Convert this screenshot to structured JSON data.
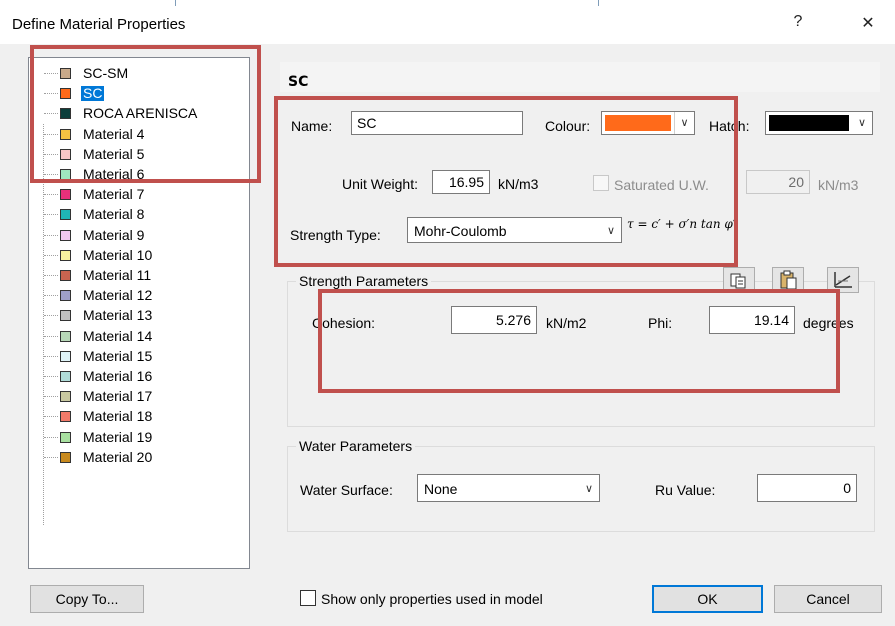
{
  "window": {
    "title": "Define Material Properties",
    "help_glyph": "?",
    "close_glyph": "✕"
  },
  "materials": [
    {
      "label": "SC-SM",
      "color": "#c8a98a",
      "selected": false
    },
    {
      "label": "SC",
      "color": "#ff6a1a",
      "selected": true
    },
    {
      "label": "ROCA ARENISCA",
      "color": "#0b3d3a",
      "selected": false
    },
    {
      "label": "Material 4",
      "color": "#f5c242",
      "selected": false
    },
    {
      "label": "Material 5",
      "color": "#f7c6c6",
      "selected": false
    },
    {
      "label": "Material 6",
      "color": "#9fe8c0",
      "selected": false
    },
    {
      "label": "Material 7",
      "color": "#e8307a",
      "selected": false
    },
    {
      "label": "Material 8",
      "color": "#1fb5b5",
      "selected": false
    },
    {
      "label": "Material 9",
      "color": "#f2c8f0",
      "selected": false
    },
    {
      "label": "Material 10",
      "color": "#f7f2a0",
      "selected": false
    },
    {
      "label": "Material 11",
      "color": "#c86450",
      "selected": false
    },
    {
      "label": "Material 12",
      "color": "#9fa0c8",
      "selected": false
    },
    {
      "label": "Material 13",
      "color": "#c0c0c0",
      "selected": false
    },
    {
      "label": "Material 14",
      "color": "#b8d8b8",
      "selected": false
    },
    {
      "label": "Material 15",
      "color": "#e0f4f8",
      "selected": false
    },
    {
      "label": "Material 16",
      "color": "#b0dcd8",
      "selected": false
    },
    {
      "label": "Material 17",
      "color": "#c8c8a0",
      "selected": false
    },
    {
      "label": "Material 18",
      "color": "#f07a6a",
      "selected": false
    },
    {
      "label": "Material 19",
      "color": "#a8e0a0",
      "selected": false
    },
    {
      "label": "Material 20",
      "color": "#c88a1e",
      "selected": false
    }
  ],
  "material_header": "SC",
  "general": {
    "name_label": "Name:",
    "name_value": "SC",
    "colour_label": "Colour:",
    "colour_value": "#ff6a1a",
    "hatch_label": "Hatch:",
    "hatch_value": "#000000",
    "unit_weight_label": "Unit Weight:",
    "unit_weight_value": "16.95",
    "unit_weight_unit": "kN/m3",
    "saturated_label": "Saturated U.W.",
    "saturated_value": "20",
    "saturated_unit": "kN/m3",
    "strength_type_label": "Strength Type:",
    "strength_type_value": "Mohr-Coulomb",
    "formula": "τ = c′ + σ′n tan φ′"
  },
  "strength_parameters": {
    "title": "Strength Parameters",
    "cohesion_label": "Cohesion:",
    "cohesion_value": "5.276",
    "cohesion_unit": "kN/m2",
    "phi_label": "Phi:",
    "phi_value": "19.14",
    "phi_unit": "degrees"
  },
  "water_parameters": {
    "title": "Water Parameters",
    "surface_label": "Water Surface:",
    "surface_value": "None",
    "ru_label": "Ru Value:",
    "ru_value": "0"
  },
  "footer": {
    "copy_to_label": "Copy To...",
    "show_only_label": "Show only properties used in model",
    "ok_label": "OK",
    "cancel_label": "Cancel"
  },
  "colors": {
    "selection": "#0078d7",
    "annotation": "#c0504d"
  },
  "icons": {
    "copy_button": "copy-icon",
    "paste_button": "paste-icon",
    "chart_button": "chart-icon"
  }
}
